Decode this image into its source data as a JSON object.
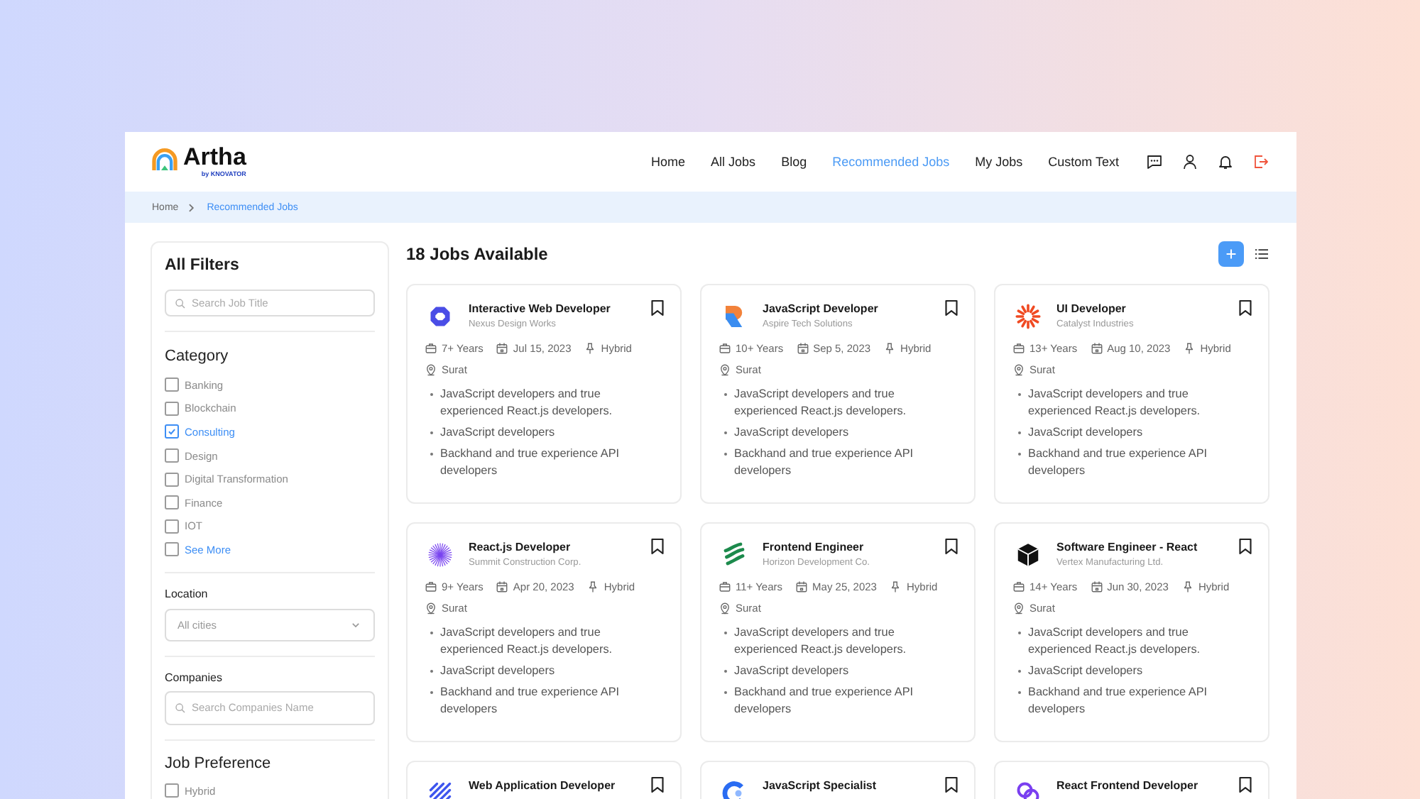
{
  "header": {
    "logo": {
      "name": "Artha",
      "byline": "by KNOVATOR"
    },
    "nav": [
      {
        "label": "Home",
        "selected": false
      },
      {
        "label": "All Jobs",
        "selected": false
      },
      {
        "label": "Blog",
        "selected": false
      },
      {
        "label": "Recommended Jobs",
        "selected": true
      },
      {
        "label": "My Jobs",
        "selected": false
      },
      {
        "label": "Custom Text",
        "selected": false
      }
    ]
  },
  "breadcrumb": [
    {
      "label": "Home",
      "selected": false
    },
    {
      "label": "Recommended Jobs",
      "selected": true
    }
  ],
  "filters": {
    "title": "All Filters",
    "search": {
      "placeholder": "Search Job Title"
    },
    "category": {
      "title": "Category",
      "items": [
        {
          "kind": "option",
          "label": "Banking",
          "checked": false
        },
        {
          "kind": "option",
          "label": "Blockchain",
          "checked": false
        },
        {
          "kind": "option",
          "label": "Consulting",
          "checked": true
        },
        {
          "kind": "option",
          "label": "Design",
          "checked": false
        },
        {
          "kind": "option",
          "label": "Digital Transformation",
          "checked": false
        },
        {
          "kind": "option",
          "label": "Finance",
          "checked": false
        },
        {
          "kind": "option",
          "label": "IOT",
          "checked": false
        },
        {
          "kind": "link",
          "label": "See More",
          "checked": false
        }
      ]
    },
    "location": {
      "label": "Location",
      "placeholder": "All cities"
    },
    "companies": {
      "label": "Companies",
      "placeholder": "Search Companies Name"
    },
    "job_preference": {
      "title": "Job Preference",
      "items": [
        {
          "label": "Hybrid",
          "checked": false
        }
      ]
    }
  },
  "jobs": {
    "heading": "18 Jobs Available",
    "cards": [
      {
        "title": "Interactive Web Developer",
        "company": "Nexus Design Works",
        "saved": false,
        "experience": "7+ Years",
        "date": "Jul 15, 2023",
        "mode": "Hybrid",
        "location": "Surat",
        "points": [
          "JavaScript developers and true experienced React.js developers.",
          "JavaScript developers",
          "Backhand and true experience API developers"
        ]
      },
      {
        "title": "JavaScript Developer",
        "company": "Aspire Tech Solutions",
        "saved": false,
        "experience": "10+ Years",
        "date": "Sep 5, 2023",
        "mode": "Hybrid",
        "location": "Surat",
        "points": [
          "JavaScript developers and true experienced React.js developers.",
          "JavaScript developers",
          "Backhand and true experience API developers"
        ]
      },
      {
        "title": "UI Developer",
        "company": "Catalyst Industries",
        "saved": false,
        "experience": "13+ Years",
        "date": "Aug 10, 2023",
        "mode": "Hybrid",
        "location": "Surat",
        "points": [
          "JavaScript developers and true experienced React.js developers.",
          "JavaScript developers",
          "Backhand and true experience API developers"
        ]
      },
      {
        "title": "React.js Developer",
        "company": "Summit Construction Corp.",
        "saved": false,
        "experience": "9+ Years",
        "date": "Apr 20, 2023",
        "mode": "Hybrid",
        "location": "Surat",
        "points": [
          "JavaScript developers and true experienced React.js developers.",
          "JavaScript developers",
          "Backhand and true experience API developers"
        ]
      },
      {
        "title": "Frontend Engineer",
        "company": "Horizon Development Co.",
        "saved": false,
        "experience": "11+ Years",
        "date": "May 25, 2023",
        "mode": "Hybrid",
        "location": "Surat",
        "points": [
          "JavaScript developers and true experienced React.js developers.",
          "JavaScript developers",
          "Backhand and true experience API developers"
        ]
      },
      {
        "title": "Software Engineer - React",
        "company": "Vertex Manufacturing Ltd.",
        "saved": false,
        "experience": "14+ Years",
        "date": "Jun 30, 2023",
        "mode": "Hybrid",
        "location": "Surat",
        "points": [
          "JavaScript developers and true experienced React.js developers.",
          "JavaScript developers",
          "Backhand and true experience API developers"
        ]
      },
      {
        "title": "Web Application Developer",
        "saved": false
      },
      {
        "title": "JavaScript Specialist",
        "saved": false
      },
      {
        "title": "React Frontend Developer",
        "saved": false
      }
    ]
  }
}
